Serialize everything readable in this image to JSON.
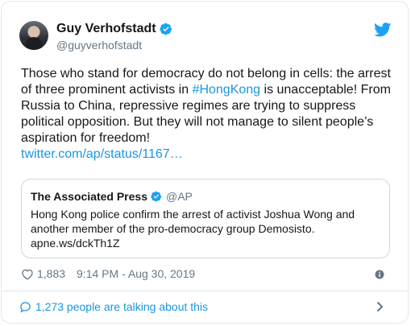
{
  "author": {
    "display_name": "Guy Verhofstadt",
    "handle": "@guyverhofstadt"
  },
  "tweet": {
    "text_before_hashtag": "Those who stand for democracy do not belong in cells: the arrest of three prominent activists in ",
    "hashtag": "#HongKong",
    "text_after_hashtag": " is unacceptable! From Russia to China, repressive regimes are trying to suppress political opposition. But they will not manage to silent people’s aspiration for freedom!",
    "link": "twitter.com/ap/status/1167…"
  },
  "quoted_tweet": {
    "display_name": "The Associated Press",
    "handle": "@AP",
    "text": "Hong Kong police confirm the arrest of activist Joshua Wong and another member of the pro-democracy group Demosisto.",
    "link": "apne.ws/dckTh1Z"
  },
  "meta": {
    "likes": "1,883",
    "timestamp": "9:14 PM - Aug 30, 2019"
  },
  "footer": {
    "talking_text": "1,273 people are talking about this"
  },
  "icons": {
    "verified": "verified-badge-icon",
    "twitter": "twitter-bird-icon",
    "heart": "heart-icon",
    "info": "info-icon",
    "comment": "comment-icon",
    "chevron": "chevron-right-icon"
  },
  "colors": {
    "brand_blue": "#1da1f2",
    "link_blue": "#1b95e0",
    "secondary_text": "#657786",
    "border": "#e1e8ed"
  }
}
